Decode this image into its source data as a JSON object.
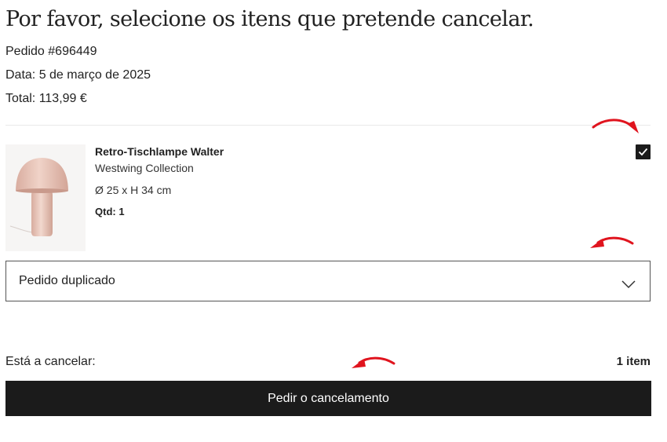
{
  "page": {
    "title": "Por favor, selecione os itens que pretende cancelar."
  },
  "order": {
    "number": "Pedido #696449",
    "date": "Data: 5 de março de 2025",
    "total": "Total: 113,99 €"
  },
  "item": {
    "name": "Retro-Tischlampe Walter",
    "brand": "Westwing Collection",
    "dimensions": "Ø 25 x H 34 cm",
    "quantity": "Qtd: 1",
    "selected": true,
    "image": "pink-mushroom-table-lamp"
  },
  "reason": {
    "selected": "Pedido duplicado",
    "icon": "chevron-down-icon"
  },
  "summary": {
    "label": "Está a cancelar:",
    "value": "1 item"
  },
  "submit": {
    "label": "Pedir o cancelamento"
  },
  "colors": {
    "text": "#222222",
    "button_bg": "#1b1b1b",
    "annotation_arrow": "#e0141e",
    "lamp": "#e9c6b9"
  }
}
